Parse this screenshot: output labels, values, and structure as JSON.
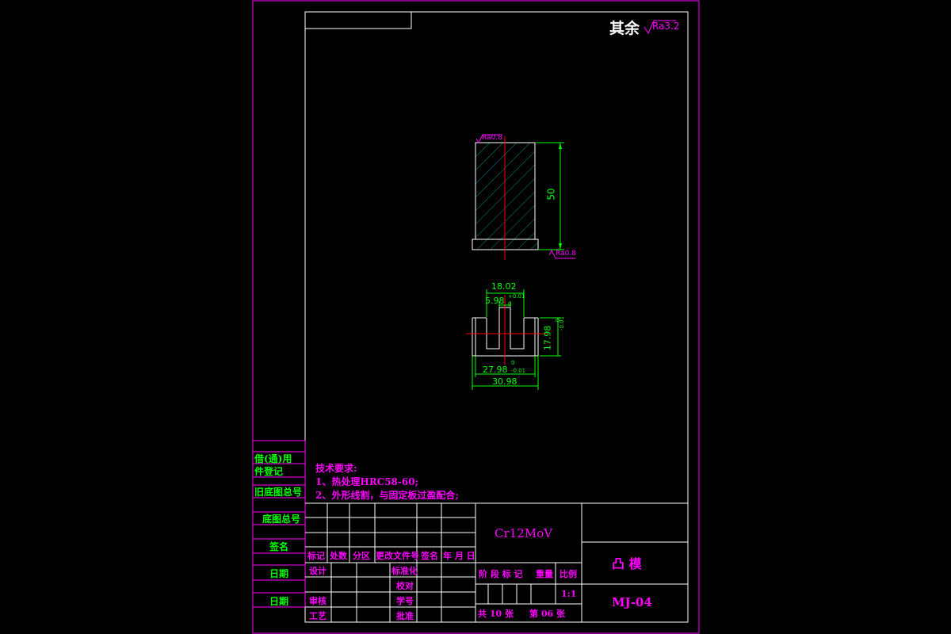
{
  "roughness_note": {
    "prefix": "其余",
    "value": "Ra3.2"
  },
  "part_view": {
    "top_roughness": "Ra0.8",
    "bottom_roughness": "Ra0.8",
    "height_dim": "50"
  },
  "section_view": {
    "dim_top": "18.02",
    "dim_slot": "5.98",
    "dim_slot_tol": "+0.01",
    "dim_slot_tol_low": "0",
    "dim_height": "17.98",
    "dim_height_tol": "0",
    "dim_height_tol_low": "-0.01",
    "dim_inner": "27.98",
    "dim_inner_tol": "0",
    "dim_inner_tol_low": "-0.01",
    "dim_outer": "30.98"
  },
  "tech_requirements": {
    "title": "技术要求:",
    "items": [
      "1、热处理HRC58-60;",
      "2、外形线割，与固定板过盈配合;"
    ]
  },
  "left_margin": {
    "labels": [
      "借(通)用",
      "件登记",
      "旧底图总号",
      "底图总号",
      "签名",
      "日期",
      "日期"
    ]
  },
  "title_block": {
    "material": "Cr12MoV",
    "part_name": "凸  模",
    "drawing_no": "MJ-04",
    "rev_headers": [
      "标记",
      "处数",
      "分区",
      "更改文件号",
      "签名",
      "年 月 日"
    ],
    "rows": {
      "design": "设计",
      "standardize": "标准化",
      "review": "审核",
      "process": "工艺",
      "approve": "批准",
      "check": "校对",
      "proofread": "学号"
    },
    "stage_headers": [
      "阶 段 标 记",
      "重量",
      "比例"
    ],
    "scale": "1:1",
    "sheets_total": "共 10 张",
    "sheet_no": "第 06 张"
  },
  "colors": {
    "frame": "#ff00ff",
    "table": "#ffffff",
    "dim": "#00ff00",
    "hatch": "#008080",
    "center": "#ff0000",
    "text_mag": "#ff00ff"
  }
}
